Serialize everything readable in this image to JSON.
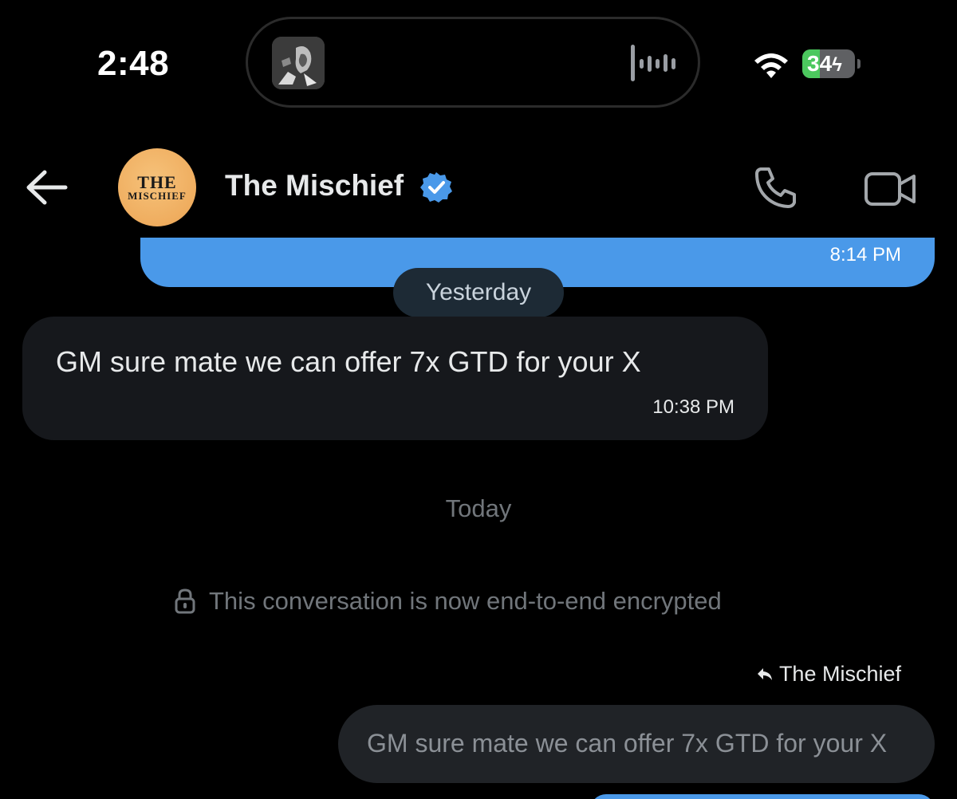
{
  "status_bar": {
    "time": "2:48",
    "battery_percent": "34",
    "battery_level": 0.34,
    "battery_color": "#4cc85e",
    "charging": true,
    "wifi_icon": "wifi-icon",
    "island_wave_icon": "audio-waveform-icon"
  },
  "header": {
    "back_icon": "arrow-left-icon",
    "avatar_line1": "THE",
    "avatar_line2": "MISCHIEF",
    "contact_name": "The Mischief",
    "verified_icon": "verified-badge-icon",
    "verified_color": "#4a99e9",
    "call_icon": "phone-icon",
    "video_icon": "video-camera-icon"
  },
  "messages": {
    "sent_top": {
      "time": "8:14 PM",
      "bubble_color": "#4a99e9"
    },
    "date_separator_1": "Yesterday",
    "received": {
      "text": "GM sure mate we can offer 7x GTD for your X",
      "time": "10:38 PM"
    },
    "date_separator_2": "Today",
    "encryption_notice": "This conversation is now end-to-end encrypted",
    "reply": {
      "label": "The Mischief",
      "icon": "reply-arrow-icon",
      "quoted_text": "GM sure mate we can offer 7x GTD for your X"
    }
  }
}
